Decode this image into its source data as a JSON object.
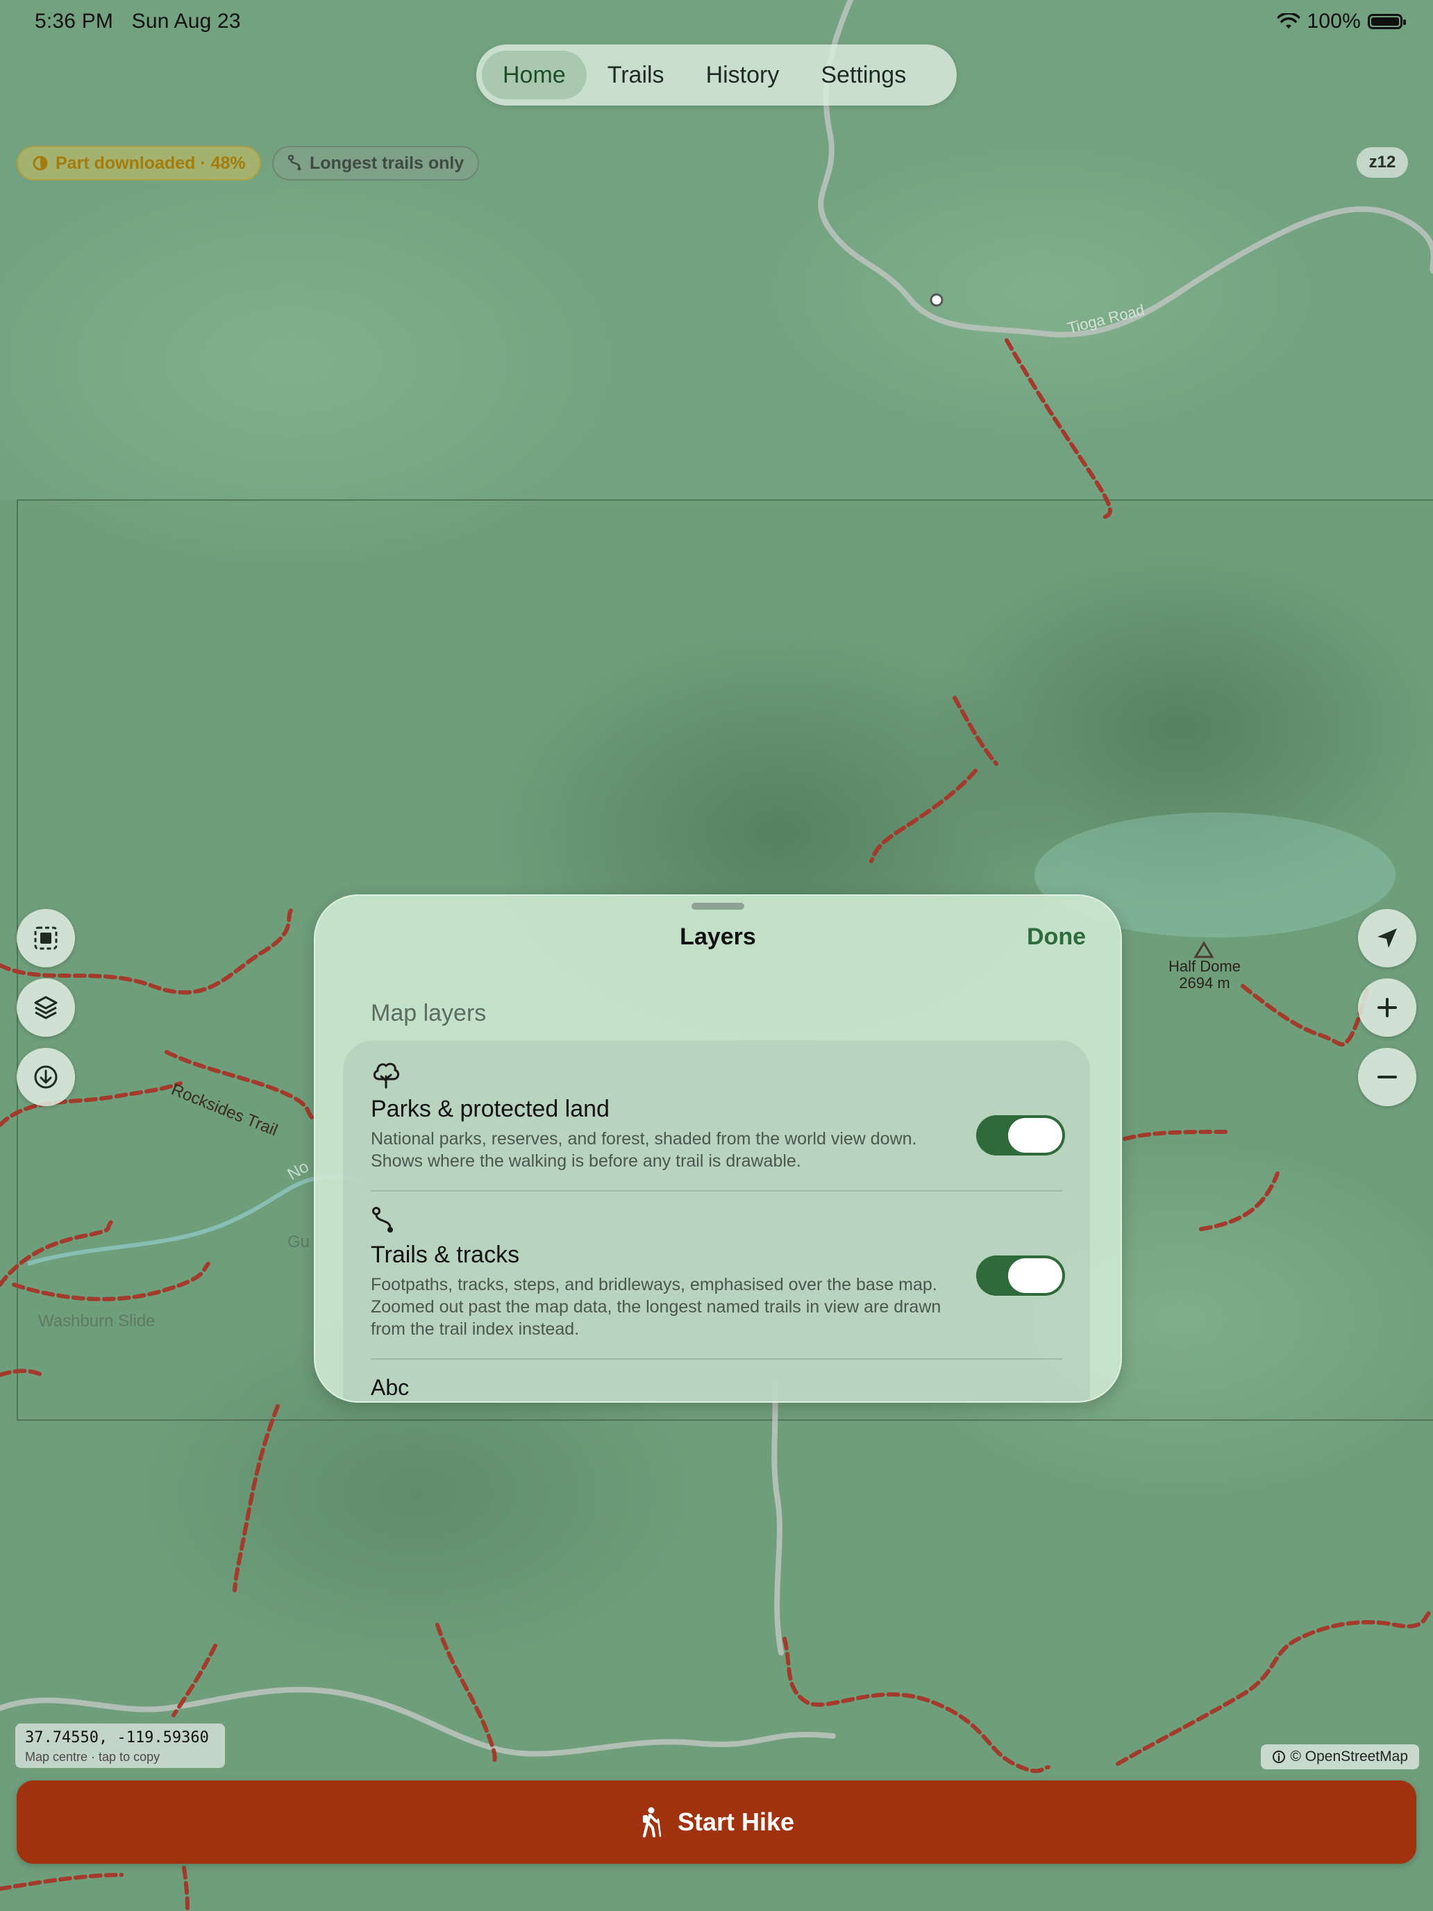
{
  "status_bar": {
    "time": "5:36 PM",
    "date": "Sun Aug 23",
    "battery": "100%",
    "battery_level": 1.0
  },
  "nav": {
    "tabs": [
      {
        "label": "Home",
        "active": true
      },
      {
        "label": "Trails",
        "active": false
      },
      {
        "label": "History",
        "active": false
      },
      {
        "label": "Settings",
        "active": false
      }
    ]
  },
  "chips": {
    "download": "Part downloaded · 48%",
    "download_progress": 0.48,
    "trails_filter": "Longest trails only"
  },
  "zoom_level": "z12",
  "map": {
    "labels": {
      "road": "Tioga Road",
      "peak_name": "Half Dome",
      "peak_elevation": "2694 m",
      "trail_rocks": "Rocksides Trail",
      "area_washburn": "Washburn Slide",
      "partial_no": "No",
      "partial_gu": "Gu"
    }
  },
  "layers_sheet": {
    "title": "Layers",
    "done_label": "Done",
    "section_title": "Map layers",
    "items": [
      {
        "title": "Parks & protected land",
        "description_line1": "National parks, reserves, and forest, shaded from the world view down.",
        "description_line2": "Shows where the walking is before any trail is drawable.",
        "enabled": true,
        "icon": "tree-icon"
      },
      {
        "title": "Trails & tracks",
        "description_line1": "Footpaths, tracks, steps, and bridleways, emphasised over the base map.",
        "description_line2": "Zoomed out past the map data, the longest named trails in view are drawn",
        "description_line3": "from the trail index instead.",
        "enabled": true,
        "icon": "route-icon"
      },
      {
        "title": "Abc",
        "icon": "text-icon"
      }
    ]
  },
  "coordinates": {
    "value": "37.74550, -119.59360",
    "hint": "Map centre · tap to copy"
  },
  "attribution": "© OpenStreetMap",
  "start_button": {
    "label": "Start Hike"
  },
  "colors": {
    "accent": "#2f6a3a",
    "start_button": "#a0320f",
    "trail": "#a33a2c"
  }
}
